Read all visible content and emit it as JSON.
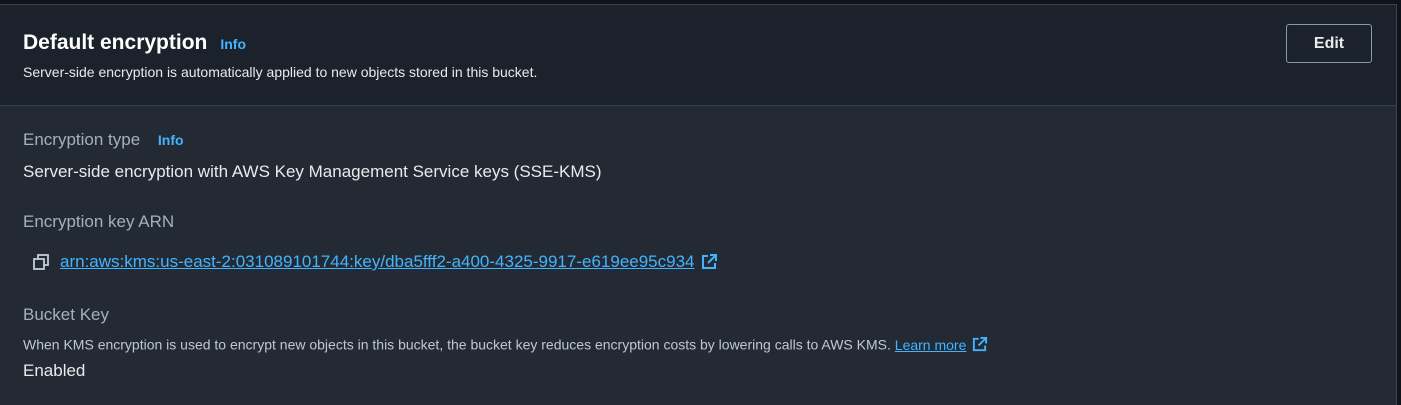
{
  "header": {
    "title": "Default encryption",
    "info_label": "Info",
    "subtitle": "Server-side encryption is automatically applied to new objects stored in this bucket.",
    "edit_label": "Edit"
  },
  "encryption_type": {
    "label": "Encryption type",
    "info_label": "Info",
    "value": "Server-side encryption with AWS Key Management Service keys (SSE-KMS)"
  },
  "encryption_key": {
    "label": "Encryption key ARN",
    "arn": "arn:aws:kms:us-east-2:031089101744:key/dba5fff2-a400-4325-9917-e619ee95c934",
    "icons": [
      "copy-icon",
      "external-link-icon"
    ]
  },
  "bucket_key": {
    "label": "Bucket Key",
    "description": "When KMS encryption is used to encrypt new objects in this bucket, the bucket key reduces encryption costs by lowering calls to AWS KMS.",
    "learn_more_label": "Learn more",
    "value": "Enabled"
  },
  "colors": {
    "link": "#42b4ff",
    "panel_bg": "#232a33",
    "header_bg": "#1b222b",
    "text": "#e8eaed",
    "label": "#a6b0bd"
  }
}
